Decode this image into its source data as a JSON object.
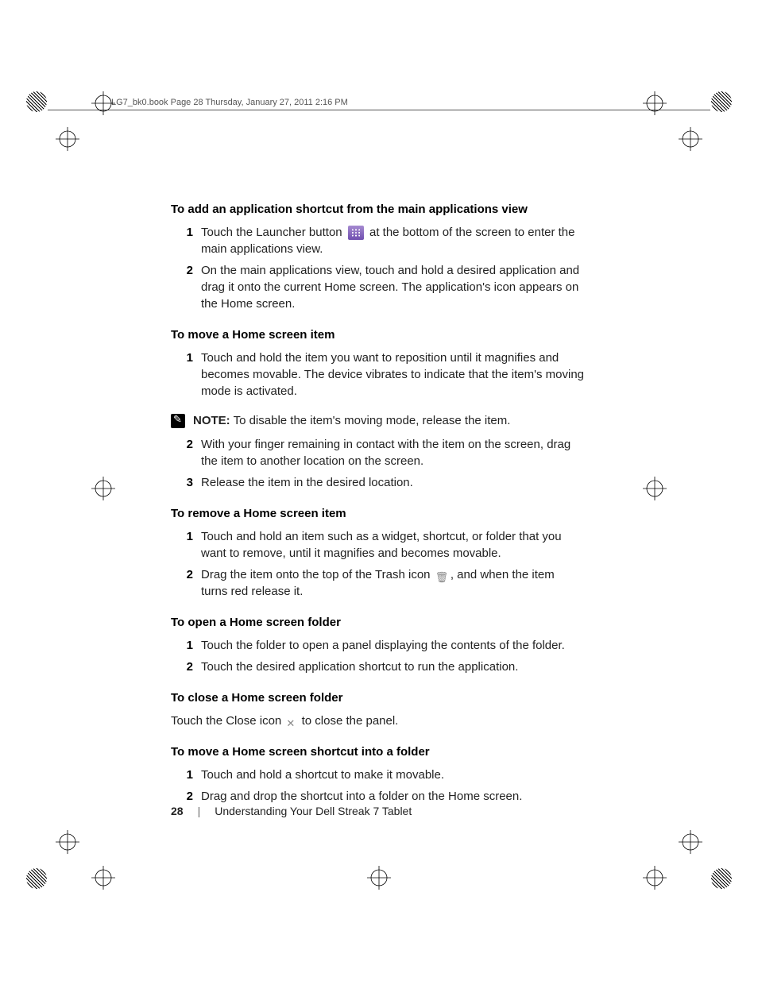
{
  "header": "LG7_bk0.book  Page 28  Thursday, January 27, 2011  2:16 PM",
  "sections": {
    "s1": {
      "title": "To add an application shortcut from the main applications view",
      "step1a": "Touch the Launcher button ",
      "step1b": " at the bottom of the screen to enter the main applications view.",
      "step2": "On the main applications view, touch and hold a desired application and drag it onto the current Home screen. The application's icon appears on the Home screen."
    },
    "s2": {
      "title": "To move a Home screen item",
      "step1": "Touch and hold the item you want to reposition until it magnifies and becomes movable. The device vibrates to indicate that the item's moving mode is activated.",
      "note_label": "NOTE:",
      "note_text": " To disable the item's moving mode, release the item.",
      "step2": "With your finger remaining in contact with the item on the screen, drag the item to another location on the screen.",
      "step3": "Release the item in the desired location."
    },
    "s3": {
      "title": "To remove a Home screen item",
      "step1": "Touch and hold an item such as a widget, shortcut, or folder that you want to remove, until it magnifies and becomes movable.",
      "step2a": "Drag the item onto the top of the Trash icon ",
      "step2b": ", and when the item turns red release it."
    },
    "s4": {
      "title": "To open a Home screen folder",
      "step1": "Touch the folder to open a panel displaying the contents of the folder.",
      "step2": "Touch the desired application shortcut to run the application."
    },
    "s5": {
      "title": "To close a Home screen folder",
      "body_a": "Touch the Close icon ",
      "body_b": " to close the panel."
    },
    "s6": {
      "title": "To move a Home screen shortcut into a folder",
      "step1": "Touch and hold a shortcut to make it movable.",
      "step2": "Drag and drop the shortcut into a folder on the Home screen."
    }
  },
  "footer": {
    "page": "28",
    "sep": "|",
    "chapter": "Understanding Your Dell Streak 7 Tablet"
  },
  "nums": {
    "n1": "1",
    "n2": "2",
    "n3": "3"
  }
}
